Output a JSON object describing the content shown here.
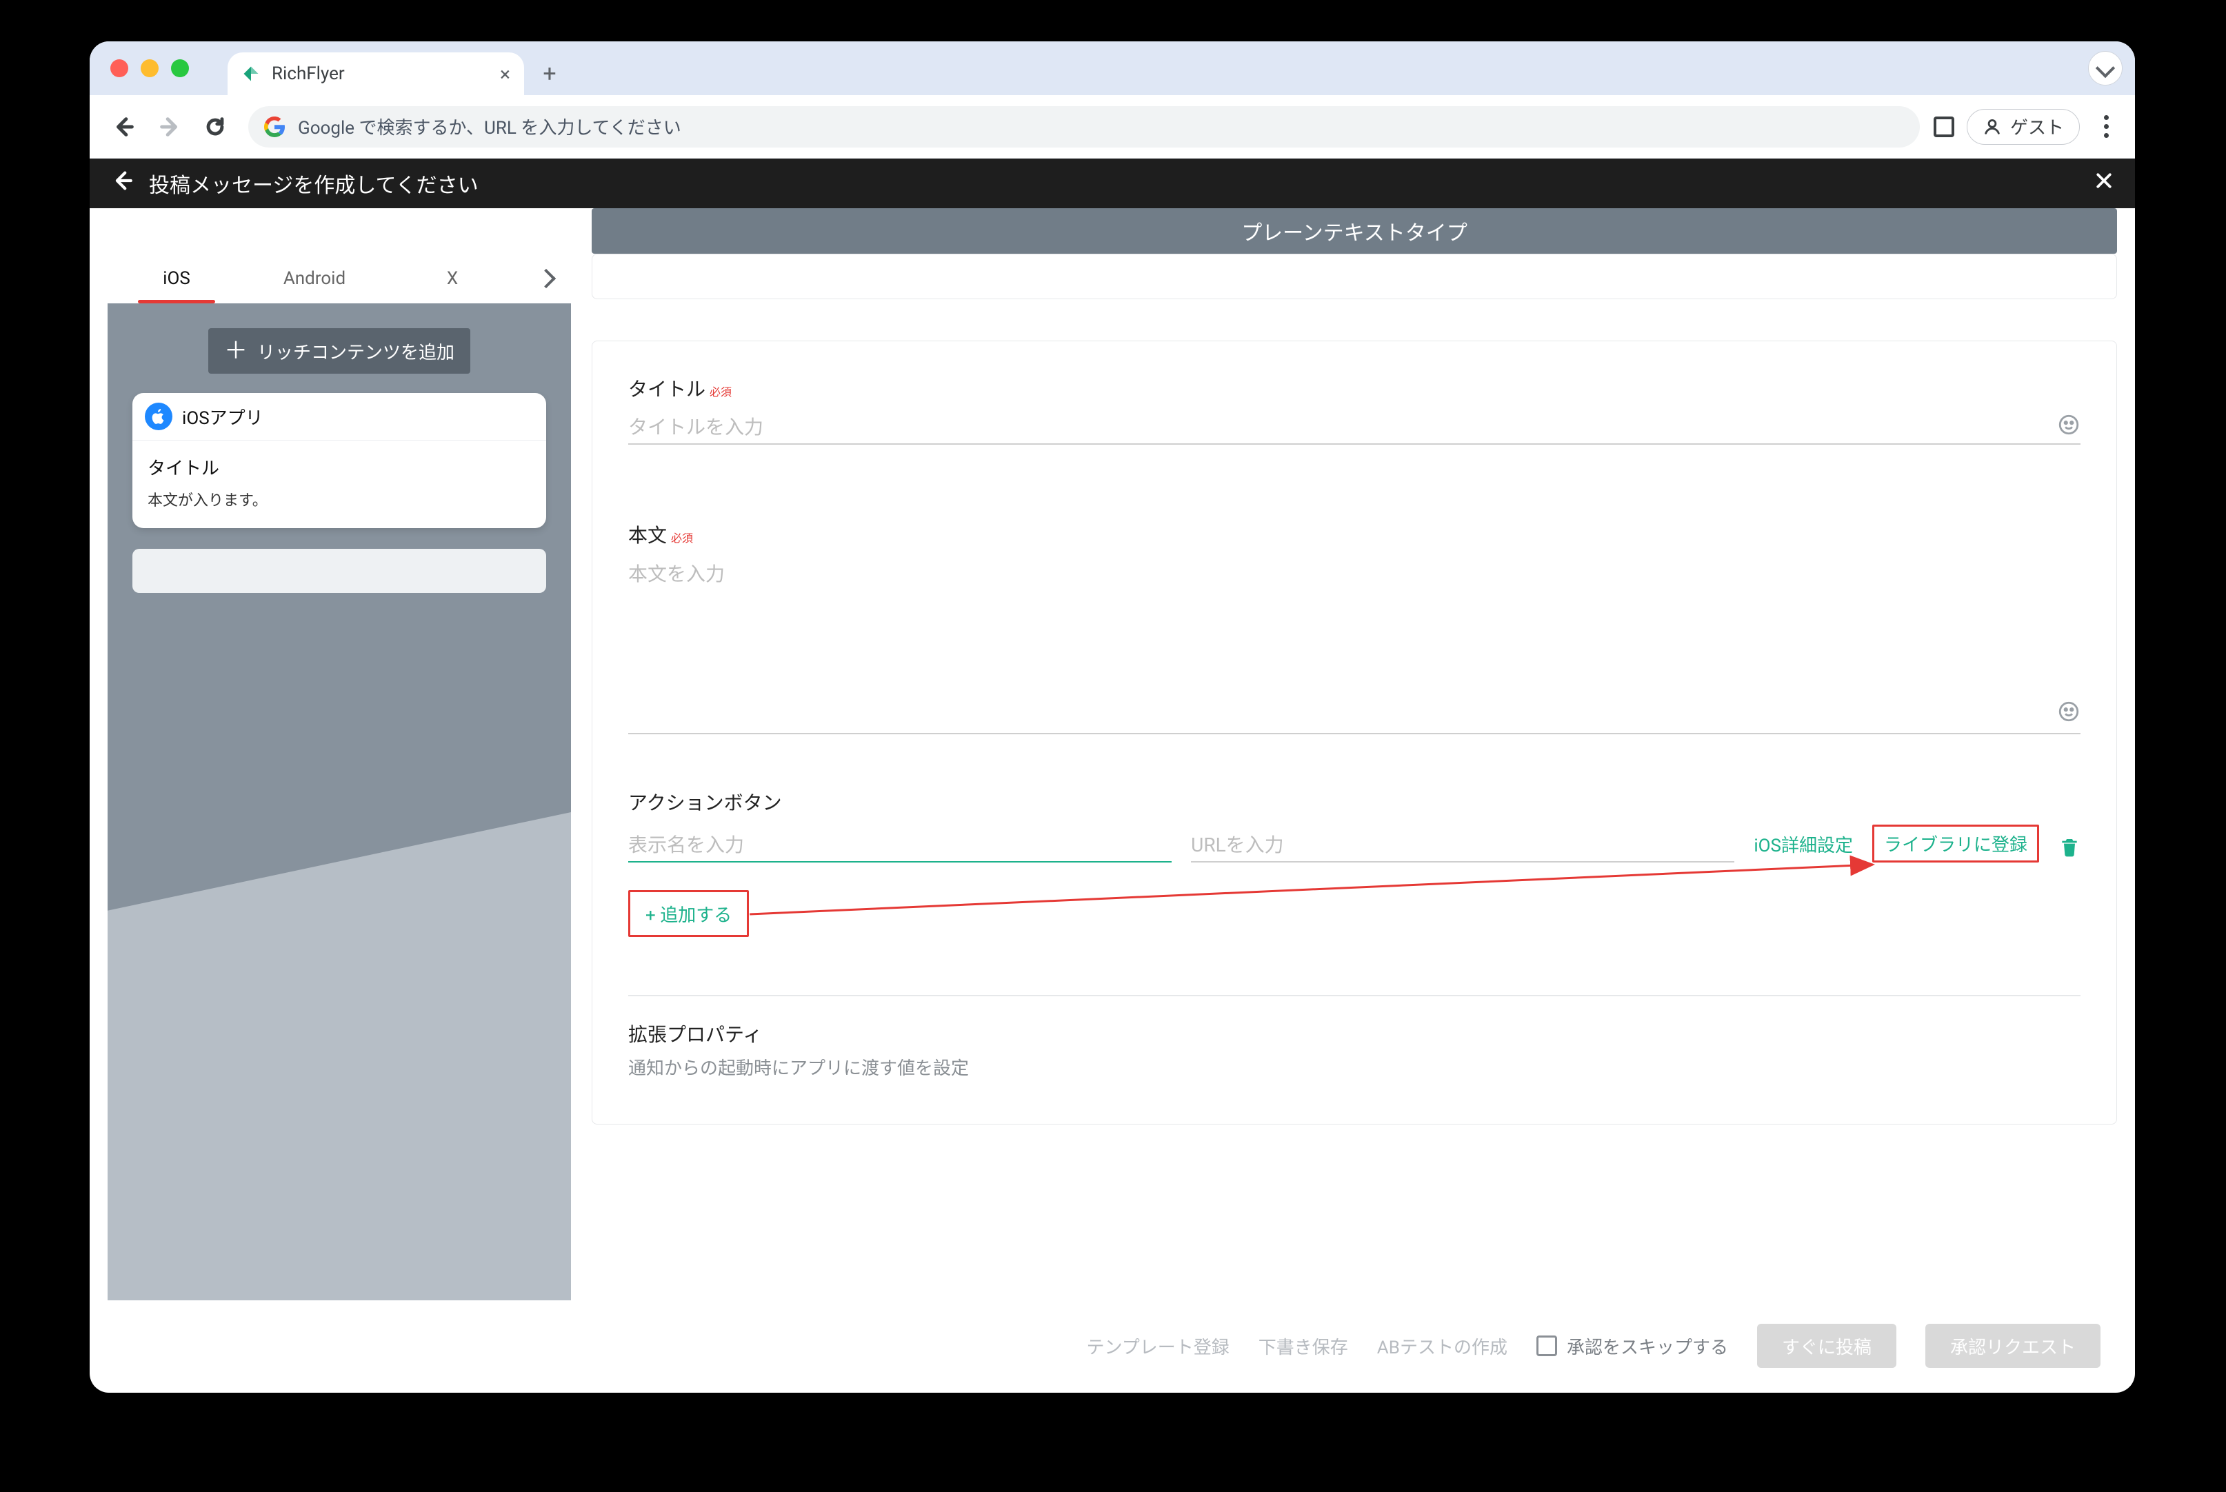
{
  "browser": {
    "tab_title": "RichFlyer",
    "omnibox_placeholder": "Google で検索するか、URL を入力してください",
    "guest_label": "ゲスト"
  },
  "app_header": {
    "title": "投稿メッセージを作成してください"
  },
  "subheader": {
    "title": "プレーンテキストタイプ"
  },
  "sidebar": {
    "tabs": {
      "ios": "iOS",
      "android": "Android",
      "x": "X"
    },
    "rich_button": "リッチコンテンツを追加",
    "card": {
      "app_name": "iOSアプリ",
      "title_label": "タイトル",
      "body_text": "本文が入ります。"
    }
  },
  "form": {
    "title": {
      "label": "タイトル",
      "required": "必須",
      "placeholder": "タイトルを入力"
    },
    "body": {
      "label": "本文",
      "required": "必須",
      "placeholder": "本文を入力"
    },
    "action": {
      "label": "アクションボタン",
      "display_placeholder": "表示名を入力",
      "url_placeholder": "URLを入力",
      "ios_detail": "iOS詳細設定",
      "register_library": "ライブラリに登録",
      "add": "+ 追加する"
    },
    "ext": {
      "label": "拡張プロパティ",
      "sub": "通知からの起動時にアプリに渡す値を設定"
    }
  },
  "footer": {
    "template": "テンプレート登録",
    "draft": "下書き保存",
    "abtest": "ABテストの作成",
    "skip_approval": "承認をスキップする",
    "post_now": "すぐに投稿",
    "request_approval": "承認リクエスト"
  }
}
